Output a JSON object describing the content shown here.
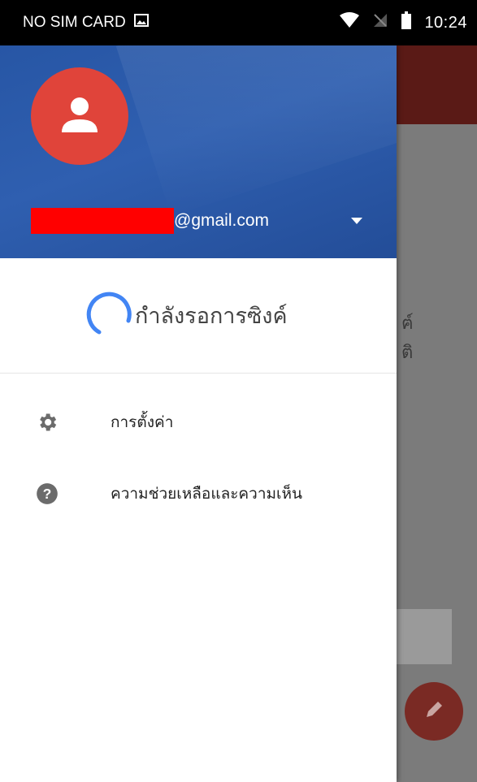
{
  "status_bar": {
    "carrier": "NO SIM CARD",
    "time": "10:24",
    "icons": [
      "image-icon",
      "wifi-icon",
      "no-signal-icon",
      "battery-icon"
    ]
  },
  "drawer": {
    "account": {
      "email_suffix": "@gmail.com",
      "avatar_icon": "person-icon",
      "dropdown_icon": "arrow-drop-down-icon"
    },
    "sync_status": "กำลังรอการซิงค์",
    "menu": [
      {
        "label": "การตั้งค่า",
        "icon": "gear-icon"
      },
      {
        "label": "ความช่วยเหลือและความเห็น",
        "icon": "help-icon"
      }
    ]
  },
  "background": {
    "text_fragments": [
      "ฅ์",
      "ติ"
    ]
  },
  "colors": {
    "header_blue": "#2f5fb0",
    "avatar_red": "#e0443a",
    "spinner_blue": "#4285f4",
    "redaction": "#ff0000",
    "fab": "#7a2a24"
  }
}
